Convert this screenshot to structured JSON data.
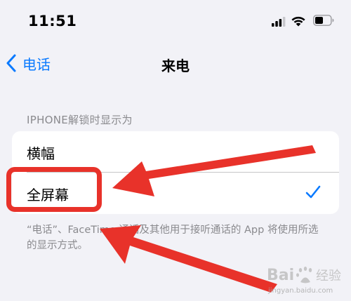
{
  "status_bar": {
    "time": "11:51"
  },
  "nav": {
    "back_label": "电话",
    "title": "来电"
  },
  "section": {
    "header": "IPHONE解锁时显示为",
    "options": [
      {
        "label": "横幅",
        "selected": false
      },
      {
        "label": "全屏幕",
        "selected": true
      }
    ],
    "footer": "“电话”、FaceTime 通话及其他用于接听通话的 App 将使用所选的显示方式。"
  },
  "annotation": {
    "color": "#e8322a"
  },
  "watermark": {
    "brand": "Bai 经验",
    "url": "jingyan.baidu.com"
  },
  "colors": {
    "accent": "#0a7aff",
    "background": "#f2f2f7",
    "secondary_text": "#8a8a8e"
  }
}
